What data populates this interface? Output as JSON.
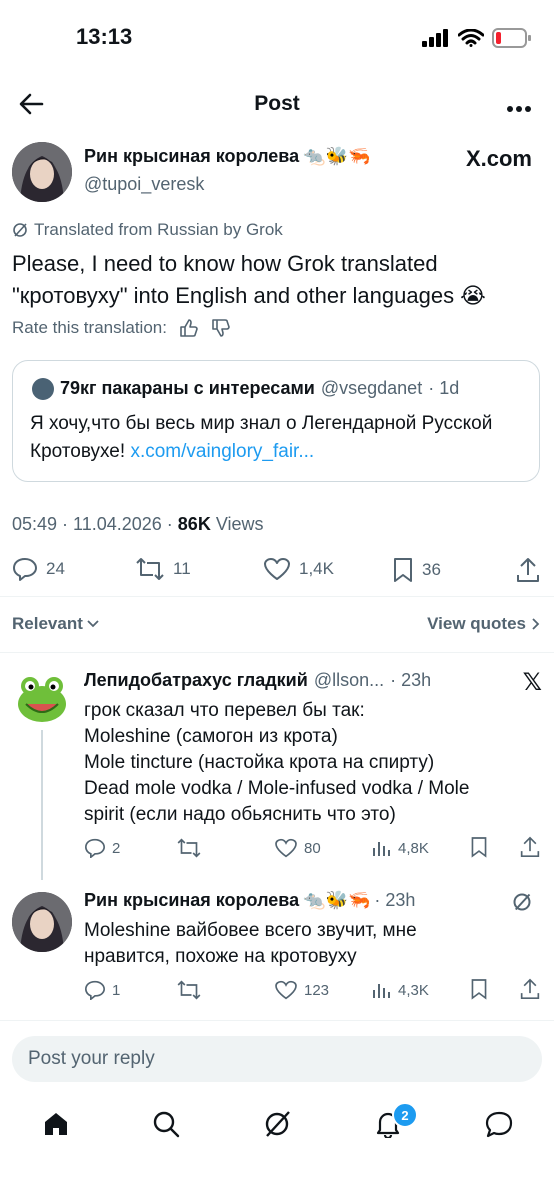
{
  "status": {
    "time": "13:13"
  },
  "header": {
    "title": "Post"
  },
  "post": {
    "author_name": "Рин крысиная королева",
    "author_emoji": "🐀🐝🦐",
    "author_handle": "@tupoi_veresk",
    "x_badge": "X.com",
    "translated_note": "Translated from Russian by Grok",
    "text": "Please, I need to know how Grok translated \"кротовуху\" into English and other languages 😭",
    "rate_label": "Rate this translation:",
    "quote": {
      "name": "79кг пакараны с интересами",
      "handle": "@vsegdanet",
      "time": "· 1d",
      "text": "Я хочу,что бы весь мир знал о Легендарной Русской Кротовухе! ",
      "link": "x.com/vainglory_fair..."
    },
    "timestamp": "05:49 · 11.04.2026 · ",
    "views_count": "86K",
    "views_label": " Views",
    "stats": {
      "replies": "24",
      "reposts": "11",
      "likes": "1,4K",
      "bookmarks": "36"
    }
  },
  "sort": {
    "relevant": "Relevant",
    "view_quotes": "View quotes"
  },
  "replies": [
    {
      "name": "Лепидобатрахус гладкий",
      "handle": "@llson...",
      "time": "· 23h",
      "text_lines": [
        "грок сказал  что перевел бы так:",
        "Moleshine (самогон  из крота)",
        "Mole tincture (настойка крота на  спирту)",
        "Dead mole vodka / Mole-infused vodka / Mole",
        "spirit (если надо обьяснить что это)"
      ],
      "stats": {
        "replies": "2",
        "likes": "80",
        "views": "4,8K"
      }
    },
    {
      "name": "Рин крысиная королева",
      "emoji": "🐀🐝🦐",
      "time": "· 23h",
      "text_lines": [
        "Moleshine вайбовее всего звучит, мне",
        "нравится, похоже на кротовуху"
      ],
      "stats": {
        "replies": "1",
        "likes": "123",
        "views": "4,3K"
      }
    }
  ],
  "composer": {
    "placeholder": "Post your reply"
  },
  "nav": {
    "notifications_badge": "2"
  },
  "colors": {
    "accent": "#1d9bf0",
    "muted": "#536471",
    "battery_low": "#f4212e"
  }
}
